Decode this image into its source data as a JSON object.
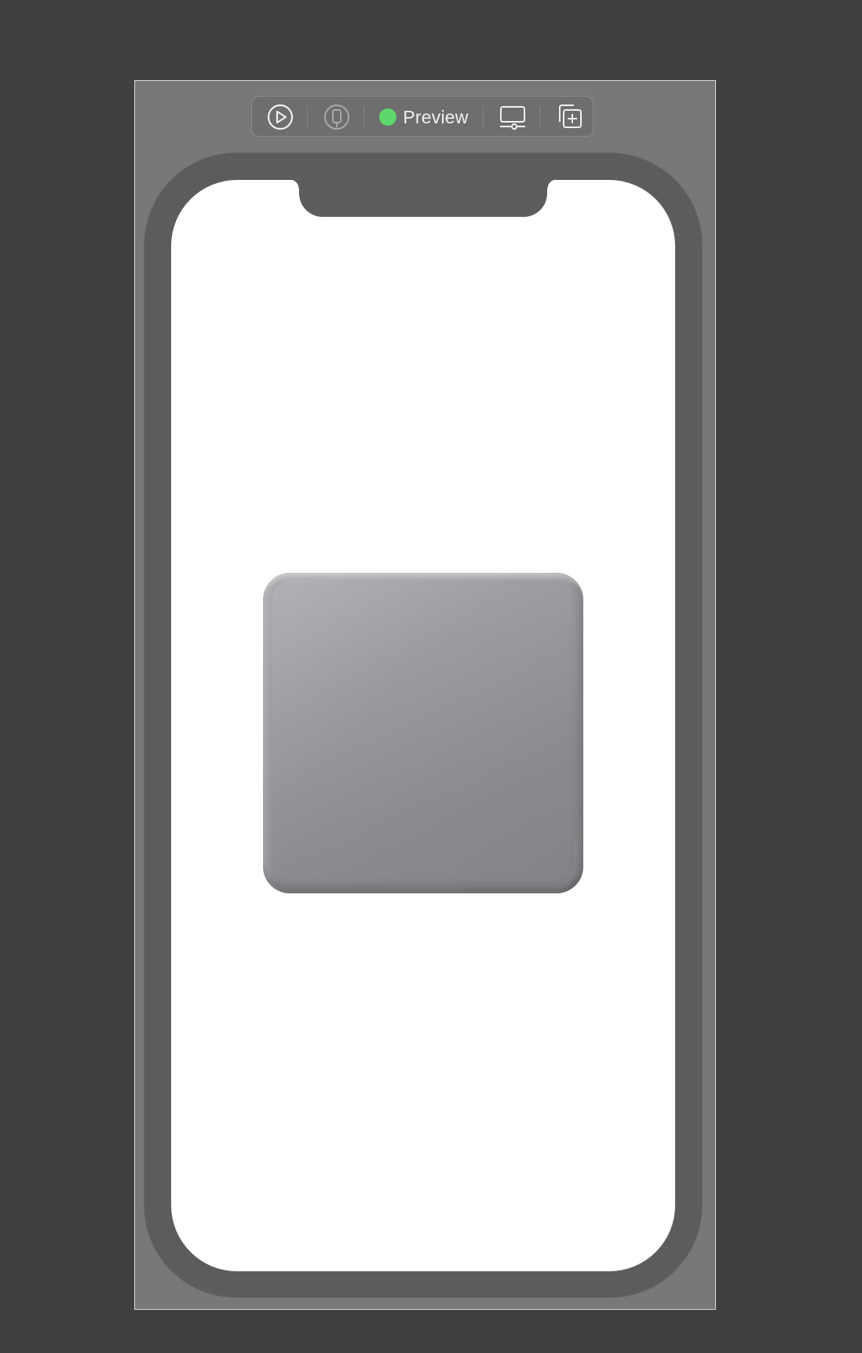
{
  "toolbar": {
    "live_button_icon": "play-circle-icon",
    "device_button_icon": "iphone-icon",
    "status_color": "#5dd86d",
    "preview_label": "Preview",
    "device_settings_icon": "display-settings-icon",
    "duplicate_icon": "duplicate-plus-icon"
  },
  "canvas": {
    "background_color": "#404040",
    "frame_color": "#787878",
    "bezel_color": "#5c5c5c",
    "screen_color": "#ffffff"
  },
  "content": {
    "shape": "rounded-square",
    "shape_color": "#9a9a9e"
  }
}
